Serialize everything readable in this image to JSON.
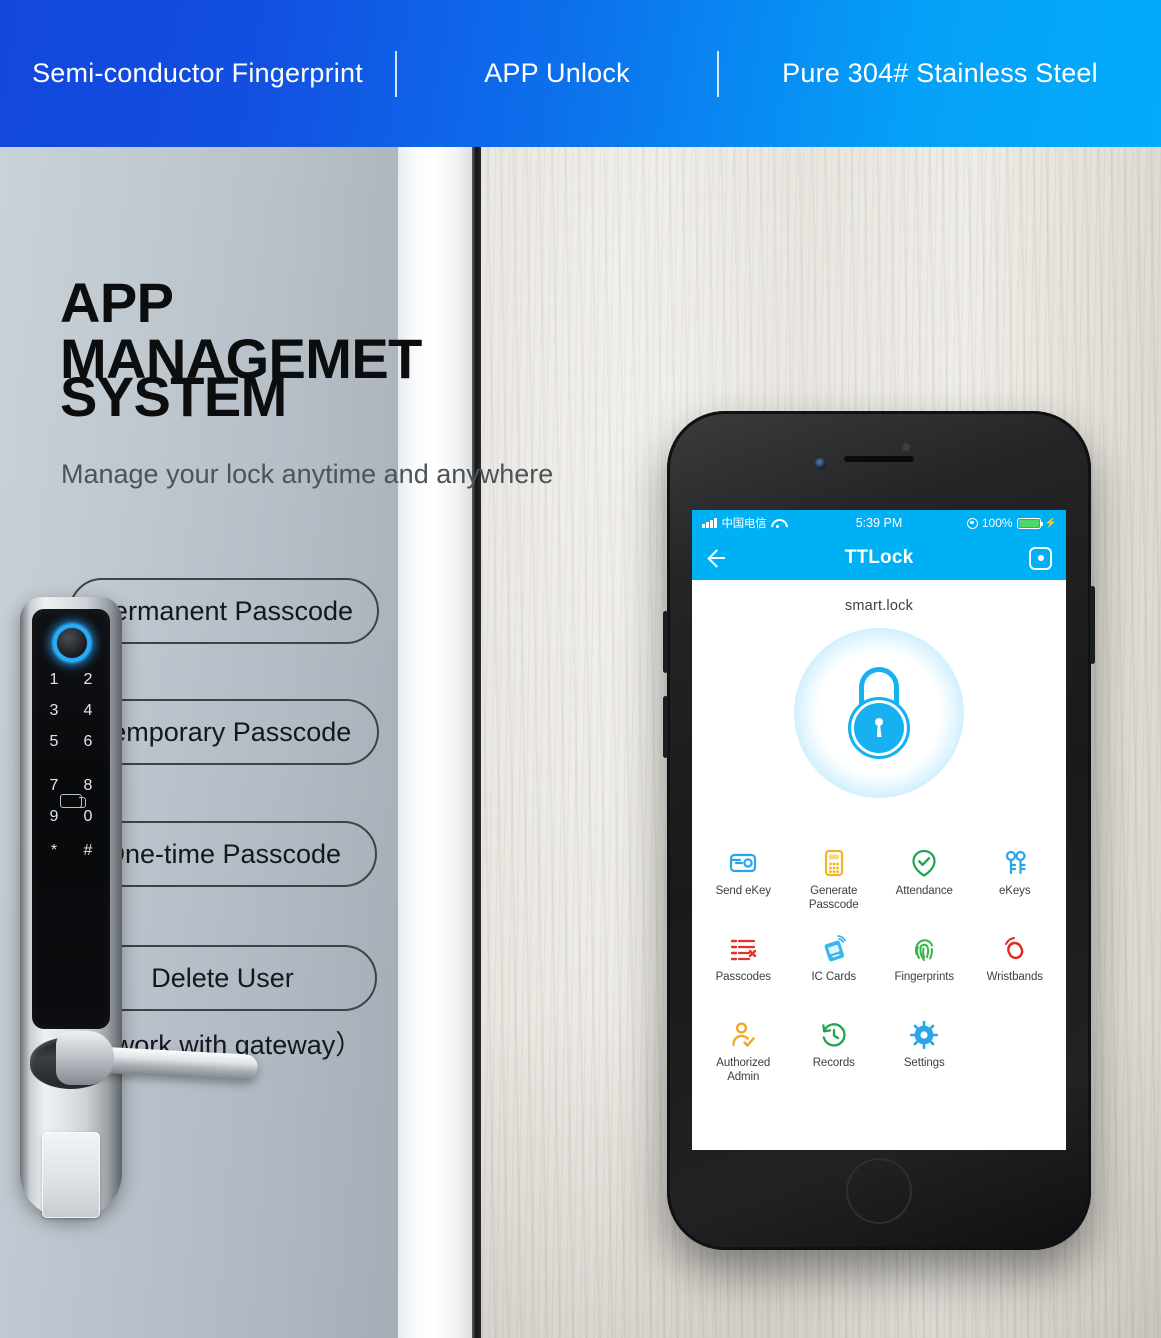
{
  "banner": {
    "items": [
      {
        "label": "Semi-conductor Fingerprint"
      },
      {
        "label": "APP Unlock"
      },
      {
        "label": "Pure 304# Stainless  Steel"
      }
    ],
    "gradient_from": "#124fe0",
    "gradient_to": "#03abfa"
  },
  "hero": {
    "title_line1": "APP MANAGEMET",
    "title_line2": "SYSTEM",
    "subtitle": "Manage your lock anytime and anywhere",
    "features": [
      {
        "label": "Permanent Passcode"
      },
      {
        "label": "Temporary Passcode"
      },
      {
        "label": "One-time Passcode"
      },
      {
        "label": "Delete User"
      }
    ],
    "note": "（work with gateway）"
  },
  "smart_lock": {
    "keypad_rows": [
      [
        "1",
        "2"
      ],
      [
        "3",
        "4"
      ],
      [
        "5",
        "6"
      ],
      [
        "7",
        "8"
      ],
      [
        "9",
        "0"
      ],
      [
        "*",
        "#"
      ]
    ],
    "fingerprint_ring_color": "#2bb4ff",
    "card_icon": "rfid-card-icon"
  },
  "phone": {
    "status_bar": {
      "carrier": "中国电信",
      "time": "5:39 PM",
      "battery_percent": "100%",
      "battery_color": "#4cd964",
      "charging_glyph": "⚡"
    },
    "nav": {
      "back_icon": "back-arrow-icon",
      "title": "TTLock",
      "right_icon": "settings-hex-icon"
    },
    "app": {
      "lock_name": "smart.lock",
      "lock_art_color": "#17b0f0",
      "grid": [
        {
          "label": "Send eKey",
          "icon": "send-ekey-icon",
          "color": "#2aa6e8"
        },
        {
          "label": "Generate\nPasscode",
          "icon": "generate-passcode-icon",
          "color": "#f0b429"
        },
        {
          "label": "Attendance",
          "icon": "attendance-check-icon",
          "color": "#1da54f"
        },
        {
          "label": "eKeys",
          "icon": "ekeys-icon",
          "color": "#2aa6e8"
        },
        {
          "label": "Passcodes",
          "icon": "passcodes-list-icon",
          "color": "#e0342b"
        },
        {
          "label": "IC Cards",
          "icon": "ic-card-icon",
          "color": "#2aa6e8"
        },
        {
          "label": "Fingerprints",
          "icon": "fingerprint-icon",
          "color": "#38b44a"
        },
        {
          "label": "Wristbands",
          "icon": "wristband-icon",
          "color": "#d92d20"
        },
        {
          "label": "Authorized\nAdmin",
          "icon": "authorized-admin-icon",
          "color": "#f0a71e"
        },
        {
          "label": "Records",
          "icon": "records-clock-icon",
          "color": "#1da54f"
        },
        {
          "label": "Settings",
          "icon": "settings-gear-icon",
          "color": "#2aa6e8"
        }
      ]
    },
    "home_button": "home-button"
  }
}
